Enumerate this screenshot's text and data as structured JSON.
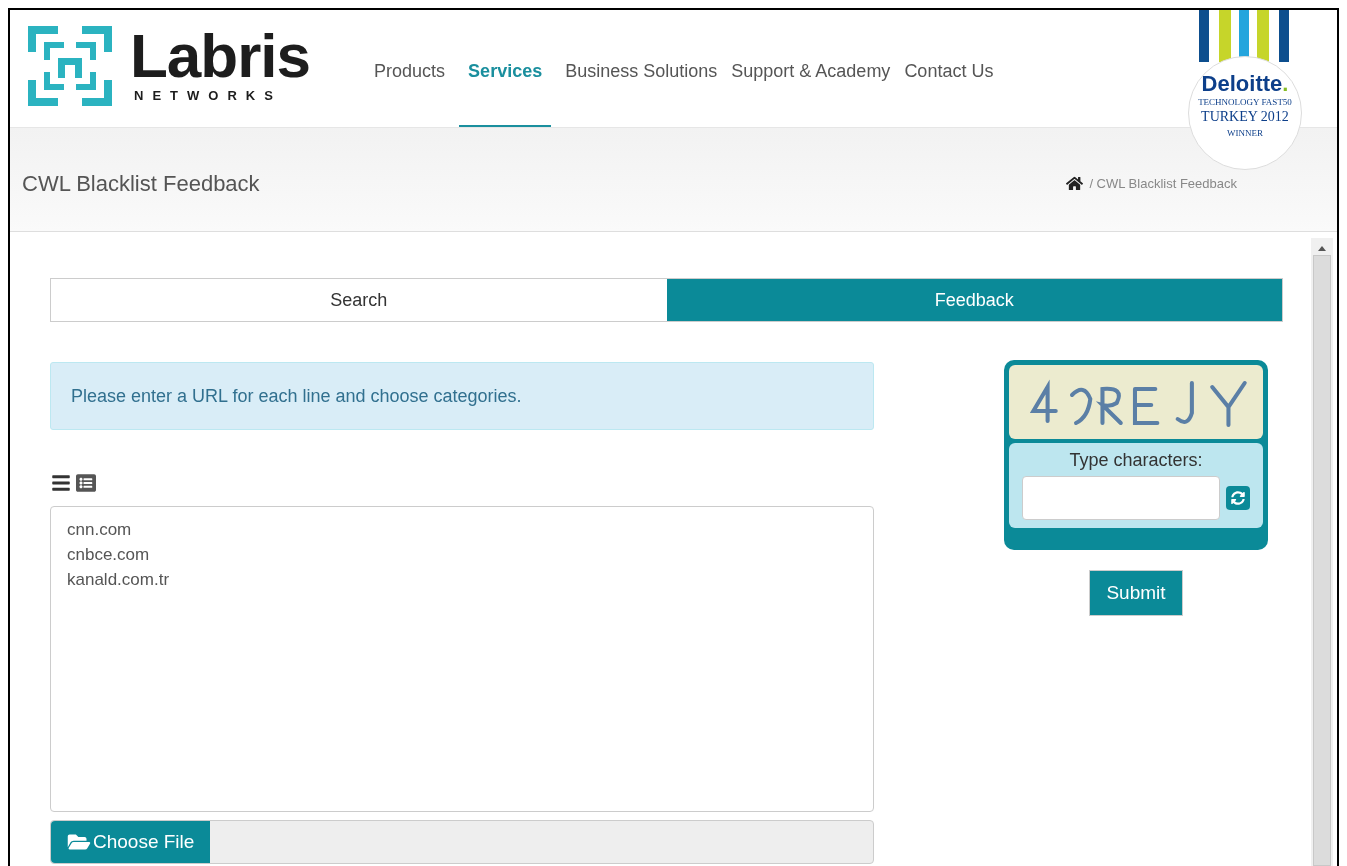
{
  "logo": {
    "name": "Labris",
    "tagline": "NETWORKS"
  },
  "nav": [
    {
      "label": "Products",
      "selected": false
    },
    {
      "label": "Services",
      "selected": true
    },
    {
      "label": "Business Solutions",
      "selected": false
    },
    {
      "label": "Support & Academy",
      "selected": false
    },
    {
      "label": "Contact Us",
      "selected": false
    }
  ],
  "badge": {
    "brand": "Deloitte",
    "dot": ".",
    "lines": [
      "TECHNOLOGY FAST50",
      "TURKEY 2012",
      "WINNER"
    ]
  },
  "page_title": "CWL Blacklist Feedback",
  "breadcrumb": "/ CWL Blacklist Feedback",
  "tabs": [
    {
      "label": "Search",
      "selected": false
    },
    {
      "label": "Feedback",
      "selected": true
    }
  ],
  "alert": "Please enter a URL for each line and choose categories.",
  "urls": [
    "cnn.com",
    "cnbce.com",
    "kanald.com.tr"
  ],
  "file_button": "Choose File",
  "captcha": {
    "kind": "picture",
    "label": "Type characters:"
  },
  "submit": "Submit"
}
